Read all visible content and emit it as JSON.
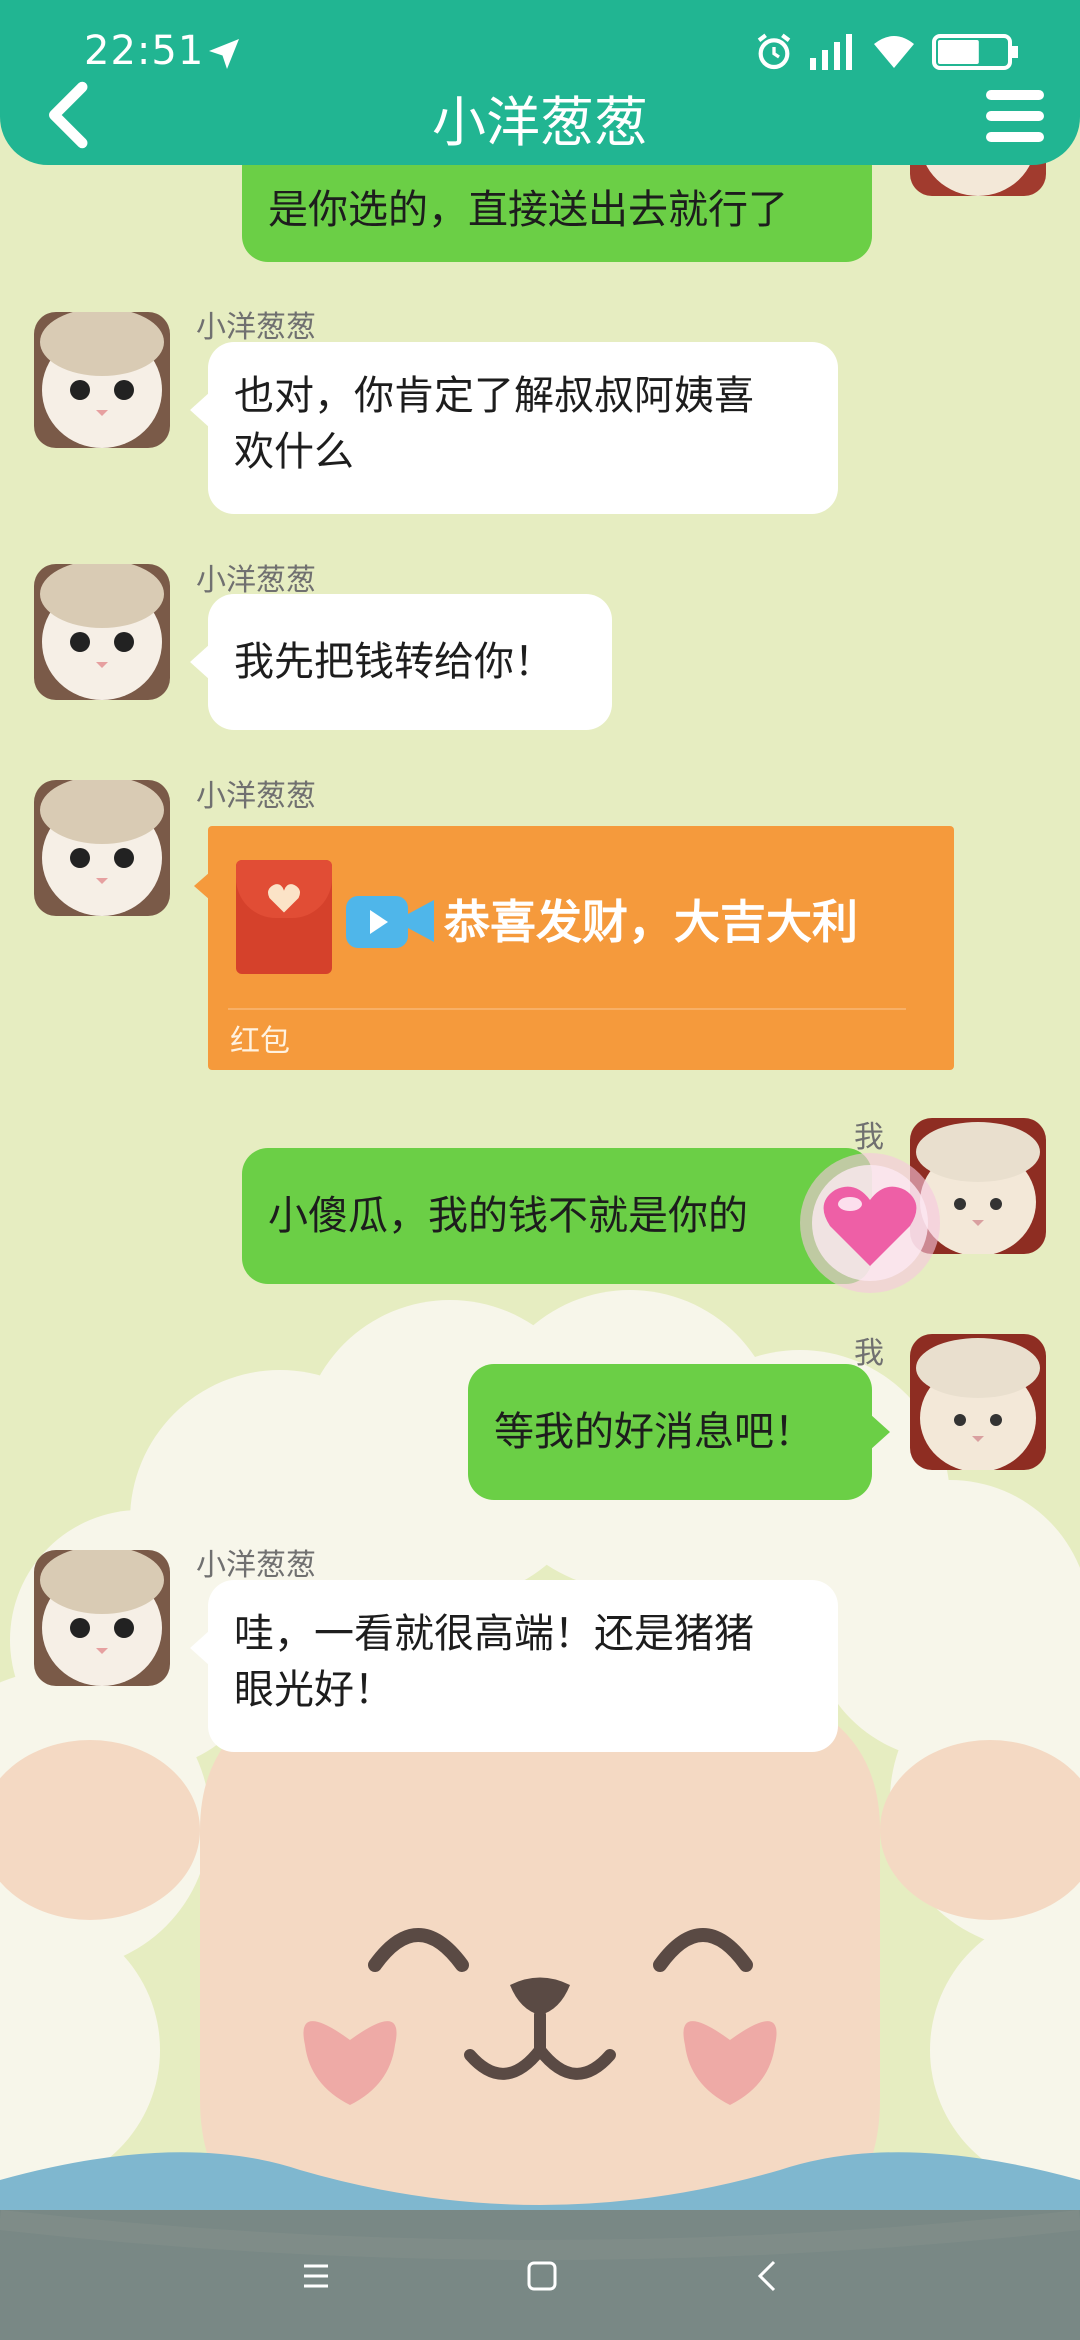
{
  "status_bar": {
    "time": "22:51",
    "battery_level": 0.6
  },
  "header": {
    "title": "小洋葱葱"
  },
  "colors": {
    "header": "#21b592",
    "incoming_bubble": "#ffffff",
    "outgoing_bubble": "#6bcf46",
    "red_packet": "#f59a3c",
    "background": "#e6edc1"
  },
  "messages": [
    {
      "side": "out",
      "sender": "",
      "text": "是你选的，直接送出去就行了"
    },
    {
      "side": "in",
      "sender": "小洋葱葱",
      "line1": "也对，你肯定了解叔叔阿姨喜",
      "line2": "欢什么"
    },
    {
      "side": "in",
      "sender": "小洋葱葱",
      "text": "我先把钱转给你！"
    },
    {
      "side": "in",
      "sender": "小洋葱葱",
      "type": "red-packet",
      "text": "恭喜发财，大吉大利",
      "label": "红包"
    },
    {
      "side": "out",
      "sender": "我",
      "text": "小傻瓜，我的钱不就是你的"
    },
    {
      "side": "out",
      "sender": "我",
      "text": "等我的好消息吧！"
    },
    {
      "side": "in",
      "sender": "小洋葱葱",
      "line1": "哇，一看就很高端！还是猪猪",
      "line2": "眼光好！"
    }
  ]
}
